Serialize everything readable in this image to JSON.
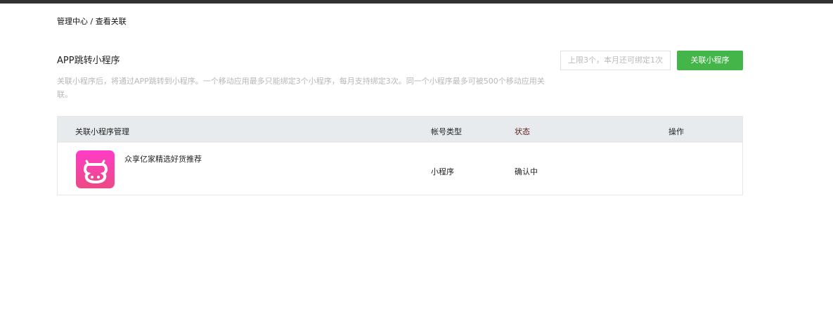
{
  "breadcrumb": "管理中心 / 查看关联",
  "title": "APP跳转小程序",
  "description": "关联小程序后，将通过APP跳转到小程序。一个移动应用最多只能绑定3个小程序，每月支持绑定3次。同一个小程序最多可被500个移动应用关联。",
  "limit_text": "上限3个，本月还可绑定1次",
  "link_button": "关联小程序",
  "table": {
    "headers": [
      "关联小程序管理",
      "帐号类型",
      "状态",
      "操作"
    ],
    "rows": [
      {
        "name": "众享亿家精选好货推荐",
        "type": "小程序",
        "status": "确认中",
        "icon": "cow-logo-icon"
      }
    ]
  },
  "colors": {
    "accent": "#44b549",
    "header_bg": "#e8ebee"
  }
}
